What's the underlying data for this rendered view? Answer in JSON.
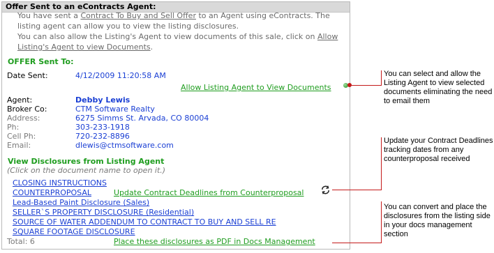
{
  "header": {
    "title": "Offer Sent to an eContracts Agent:"
  },
  "intro": {
    "t1": "You have sent a ",
    "link1": "Contract To Buy and Sell Offer",
    "t2": " to an Agent using eContracts. The listing agent can allow you to view the listing disclosures.",
    "t3": "You can also allow the Listing's Agent to view documents of this sale, click on ",
    "link2": "Allow Listing's Agent to view Documents",
    "t4": "."
  },
  "offer": {
    "heading": "OFFER Sent To:",
    "date_label": "Date Sent:",
    "date_value": "4/12/2009 11:20:58 AM",
    "allow_link": "Allow Listing Agent to View Documents",
    "agent_label": "Agent:",
    "agent_value": "Debby Lewis",
    "broker_label": "Broker Co:",
    "broker_value": "CTM Software Realty",
    "address_label": "Address:",
    "address_value": "6275 Simms St. Arvada, CO 80004",
    "ph_label": "Ph:",
    "ph_value": "303-233-1918",
    "cell_label": "Cell Ph:",
    "cell_value": "720-232-8896",
    "email_label": "Email:",
    "email_value": "dlewis@ctmsoftware.com"
  },
  "disclosures": {
    "heading": "View Disclosures from Listing Agent",
    "note": "(Click on the document name to open it.)",
    "items": [
      "CLOSING INSTRUCTIONS",
      "COUNTERPROPOSAL",
      "Lead-Based Paint Disclosure (Sales)",
      "SELLER`S PROPERTY DISCLOSURE (Residential)",
      "SOURCE OF WATER ADDENDUM TO CONTRACT TO BUY AND SELL RE",
      "SQUARE FOOTAGE DISCLOSURE"
    ],
    "update_link": "Update Contract Deadlines from Counterproposal",
    "total": "Total: 6",
    "pdf_link": "Place these disclosures as PDF in Docs Management"
  },
  "callouts": {
    "c1": [
      "You can select and allow the",
      "Listing Agent to view selected",
      "documents eliminating the need",
      "to email them"
    ],
    "c2": [
      "Update your Contract Deadlines",
      "tracking dates from any",
      "counterproposal received"
    ],
    "c3": [
      "You can convert and place the",
      "disclosures from the listing side",
      "in your docs management",
      "section"
    ]
  },
  "colors": {
    "accent_green": "#1f9d1f",
    "link_blue": "#1a3fd4",
    "callout_red": "#c41a1a"
  }
}
